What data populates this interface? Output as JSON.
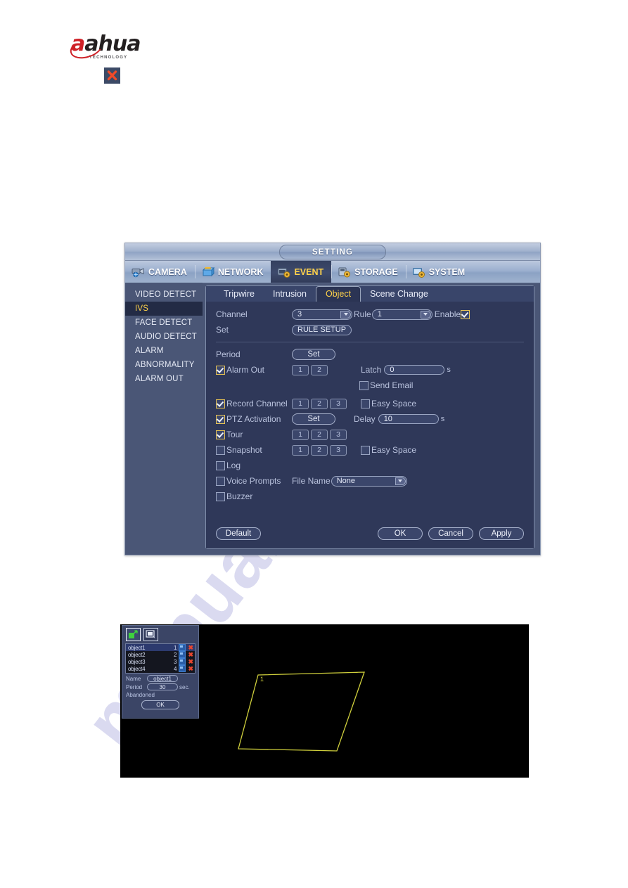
{
  "brand": {
    "logo_text": "ahua",
    "logo_accent_letter": "a",
    "logo_sub": "TECHNOLOGY",
    "close_icon": "close-icon"
  },
  "dialog": {
    "title": "SETTING",
    "menu": [
      {
        "label": "CAMERA",
        "icon": "camera-icon",
        "active": false
      },
      {
        "label": "NETWORK",
        "icon": "network-icon",
        "active": false
      },
      {
        "label": "EVENT",
        "icon": "event-icon",
        "active": true
      },
      {
        "label": "STORAGE",
        "icon": "storage-icon",
        "active": false
      },
      {
        "label": "SYSTEM",
        "icon": "system-icon",
        "active": false
      }
    ],
    "sidebar": [
      {
        "label": "VIDEO DETECT",
        "active": false
      },
      {
        "label": "IVS",
        "active": true
      },
      {
        "label": "FACE DETECT",
        "active": false
      },
      {
        "label": "AUDIO DETECT",
        "active": false
      },
      {
        "label": "ALARM",
        "active": false
      },
      {
        "label": "ABNORMALITY",
        "active": false
      },
      {
        "label": "ALARM OUT",
        "active": false
      }
    ],
    "tabs": [
      {
        "label": "Tripwire",
        "active": false
      },
      {
        "label": "Intrusion",
        "active": false
      },
      {
        "label": "Object",
        "active": true
      },
      {
        "label": "Scene Change",
        "active": false
      }
    ],
    "form": {
      "channel_label": "Channel",
      "channel_value": "3",
      "rule_label": "Rule",
      "rule_value": "1",
      "enable_label": "Enable",
      "enable_checked": true,
      "set_label": "Set",
      "rule_setup_label": "RULE SETUP",
      "period_label": "Period",
      "period_button": "Set",
      "alarm_out_label": "Alarm Out",
      "alarm_out_checked": true,
      "alarm_out_channels": [
        "1",
        "2"
      ],
      "latch_label": "Latch",
      "latch_value": "0",
      "latch_unit": "s",
      "send_email_label": "Send Email",
      "send_email_checked": false,
      "record_channel_label": "Record Channel",
      "record_channel_checked": true,
      "record_channels": [
        "1",
        "2",
        "3"
      ],
      "easy_space_label": "Easy Space",
      "easy_space_record_checked": false,
      "ptz_label": "PTZ Activation",
      "ptz_checked": true,
      "ptz_button": "Set",
      "delay_label": "Delay",
      "delay_value": "10",
      "delay_unit": "s",
      "tour_label": "Tour",
      "tour_checked": true,
      "tour_channels": [
        "1",
        "2",
        "3"
      ],
      "snapshot_label": "Snapshot",
      "snapshot_checked": false,
      "snapshot_channels": [
        "1",
        "2",
        "3"
      ],
      "easy_space_snapshot_checked": false,
      "log_label": "Log",
      "log_checked": false,
      "voice_prompts_label": "Voice Prompts",
      "voice_prompts_checked": false,
      "file_name_label": "File Name",
      "file_name_value": "None",
      "buzzer_label": "Buzzer",
      "buzzer_checked": false
    },
    "footer": {
      "default_label": "Default",
      "ok_label": "OK",
      "cancel_label": "Cancel",
      "apply_label": "Apply"
    }
  },
  "video": {
    "tools": [
      {
        "icon": "draw-polygon-icon",
        "selected": true
      },
      {
        "icon": "select-rectangle-icon",
        "selected": false
      }
    ],
    "objects": [
      {
        "name": "object1",
        "num": "1",
        "selected": true
      },
      {
        "name": "object2",
        "num": "2",
        "selected": false
      },
      {
        "name": "object3",
        "num": "3",
        "selected": false
      },
      {
        "name": "object4",
        "num": "4",
        "selected": false
      }
    ],
    "name_label": "Name",
    "name_value": "object1",
    "period_label": "Period",
    "period_value": "30",
    "period_unit": "sec.",
    "mode_label": "Abandoned",
    "ok_label": "OK",
    "region_label": "1",
    "region_color": "#cfcf3c"
  },
  "watermark": {
    "text": "manualslib.com"
  },
  "colors": {
    "panel_bg": "#2f3859",
    "dialog_bg": "#4a5676",
    "accent_yellow": "#ffd24a",
    "text": "#c3cbe4",
    "delete_red": "#e8462f",
    "draw_green": "#3ed13e"
  }
}
